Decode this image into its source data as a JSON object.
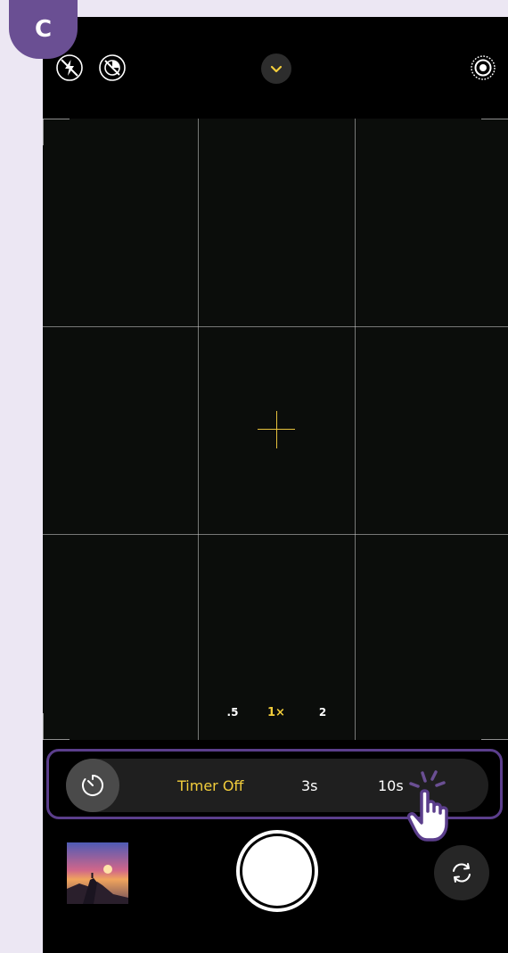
{
  "step_badge": {
    "letter": "C",
    "color": "#6a4f93"
  },
  "top_bar": {
    "icons": [
      "flash-off-icon",
      "live-photo-off-icon",
      "chevron-down-icon",
      "live-photo-icon"
    ]
  },
  "viewfinder": {
    "grid": "3x3",
    "focus_color": "#e6c23e"
  },
  "zoom": {
    "options": [
      {
        "label": ".5",
        "active": false
      },
      {
        "label": "1×",
        "active": true
      },
      {
        "label": "2",
        "active": false
      }
    ],
    "active_color": "#f2cd3b"
  },
  "timer": {
    "options": [
      {
        "label": "Timer Off",
        "selected": true
      },
      {
        "label": "3s",
        "selected": false
      },
      {
        "label": "10s",
        "selected": false
      }
    ],
    "highlight_color": "#5b3e8c",
    "icon": "timer-icon"
  },
  "bottom": {
    "thumbnail": "photo-thumbnail",
    "shutter": "shutter-button",
    "flip": "camera-flip-icon"
  },
  "annotation": {
    "icon": "tap-hand-icon",
    "target": "10s"
  }
}
